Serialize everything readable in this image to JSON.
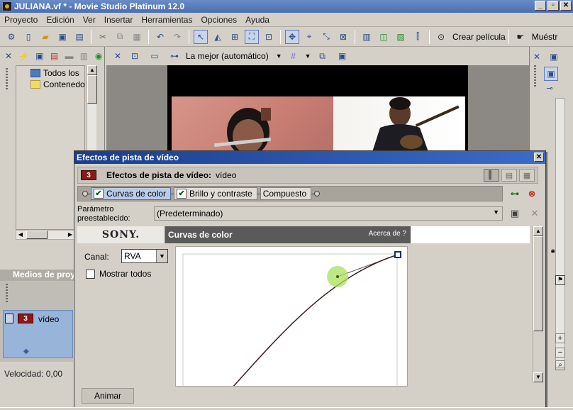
{
  "window": {
    "title": "JULIANA.vf * - Movie Studio Platinum 12.0",
    "controls": [
      "_",
      "▫",
      "✕"
    ]
  },
  "menu": [
    "Proyecto",
    "Edición",
    "Ver",
    "Insertar",
    "Herramientas",
    "Opciones",
    "Ayuda"
  ],
  "toolbar": {
    "make_movie_label": "Crear película",
    "show_label": "Muéstr"
  },
  "left_panel": {
    "tree_items": [
      "Todos los",
      "Contenedor"
    ],
    "tab_label": "Medios de proy",
    "track": {
      "badge": "3",
      "name": "vídeo"
    },
    "speed": "Velocidad: 0,00"
  },
  "preview": {
    "quality": "La mejor (automático)"
  },
  "dialog": {
    "title": "Efectos de pista de vídeo",
    "header_title": "Efectos de pista de vídeo:",
    "header_track": "vídeo",
    "header_badge": "3",
    "chain": [
      {
        "label": "Curvas de color",
        "checked": true,
        "selected": true
      },
      {
        "label": "Brillo y contraste",
        "checked": true,
        "selected": false
      },
      {
        "label": "Compuesto",
        "checked": false,
        "selected": false
      }
    ],
    "preset_label": "Parámetro preestablecido:",
    "preset_value": "(Predeterminado)",
    "plugin": {
      "brand": "SONY.",
      "name": "Curvas de color",
      "about": "Acerca de   ?",
      "channel_label": "Canal:",
      "channel_value": "RVA",
      "show_all_label": "Mostrar todos"
    },
    "animate_label": "Animar"
  },
  "colors": {
    "dialog_title": "#1a3e8c",
    "track_badge": "#8a1a1a",
    "track_row": "#98b4d8",
    "curve": "#3a1f1f",
    "control_point": "#a8e05a"
  }
}
